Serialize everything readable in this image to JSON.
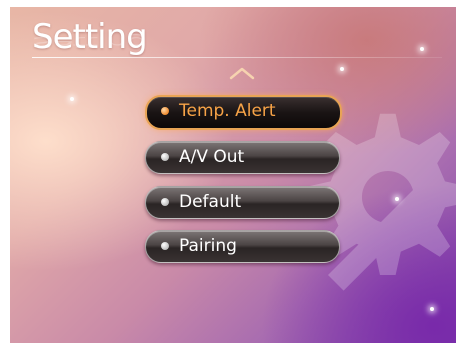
{
  "screen": {
    "title": "Setting"
  },
  "menu": {
    "items": [
      {
        "label": "Temp. Alert",
        "selected": true
      },
      {
        "label": "A/V Out",
        "selected": false
      },
      {
        "label": "Default",
        "selected": false
      },
      {
        "label": "Pairing",
        "selected": false
      }
    ]
  },
  "icons": {
    "scroll_up": "chevron-up-icon",
    "background": "gear-icon",
    "bullet": "dot-icon"
  },
  "colors": {
    "accent": "#f7a347",
    "selected_border": "#e8a455",
    "text": "#ffffff"
  }
}
